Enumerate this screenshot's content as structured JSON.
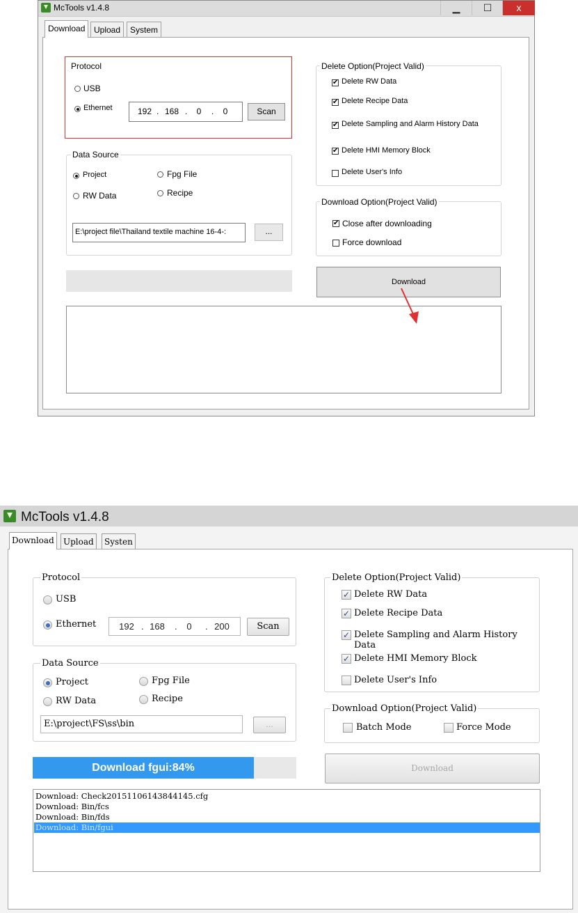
{
  "window1": {
    "title": "McTools v1.4.8",
    "controls": {
      "minimize": "▁",
      "maximize": "☐",
      "close": "x"
    },
    "tabs": [
      "Download",
      "Upload",
      "System"
    ],
    "protocol": {
      "legend": "Protocol",
      "usb_label": "USB",
      "ethernet_label": "Ethernet",
      "selected": "Ethernet",
      "ip": [
        "192",
        "168",
        "0",
        "0"
      ],
      "scan_label": "Scan",
      "highlight_color": "#e03030"
    },
    "data_source": {
      "legend": "Data Source",
      "options": [
        "Project",
        "Fpg File",
        "RW Data",
        "Recipe"
      ],
      "selected": "Project",
      "path": "E:\\project file\\Thailand textile machine 16-4-:",
      "browse_label": "..."
    },
    "delete_option": {
      "legend": "Delete Option(Project Valid)",
      "items": [
        {
          "label": "Delete RW Data",
          "checked": true
        },
        {
          "label": "Delete Recipe Data",
          "checked": true
        },
        {
          "label": "Delete Sampling and Alarm History Data",
          "checked": true
        },
        {
          "label": "Delete HMI Memory Block",
          "checked": true
        },
        {
          "label": "Delete User's Info",
          "checked": false
        }
      ]
    },
    "download_option": {
      "legend": "Download Option(Project Valid)",
      "items": [
        {
          "label": "Close after downloading",
          "checked": true
        },
        {
          "label": "Force download",
          "checked": false
        }
      ]
    },
    "download_label": "Download",
    "progress": 0,
    "arrow_color": "#e03030"
  },
  "window2": {
    "title": "McTools v1.4.8",
    "tabs": [
      "Download",
      "Upload",
      "Systen"
    ],
    "protocol": {
      "legend": "Protocol",
      "usb_label": "USB",
      "ethernet_label": "Ethernet",
      "selected": "Ethernet",
      "ip": [
        "192",
        "168",
        "0",
        "200"
      ],
      "scan_label": "Scan"
    },
    "data_source": {
      "legend": "Data Source",
      "options": [
        "Project",
        "Fpg File",
        "RW Data",
        "Recipe"
      ],
      "selected": "Project",
      "path": "E:\\project\\FS\\ss\\bin",
      "browse_label": "..."
    },
    "delete_option": {
      "legend": "Delete Option(Project Valid)",
      "items": [
        {
          "label": "Delete RW Data",
          "checked": true
        },
        {
          "label": "Delete Recipe Data",
          "checked": true
        },
        {
          "label": "Delete Sampling and Alarm History",
          "label_line2": "Data",
          "checked": true
        },
        {
          "label": "Delete HMI Memory Block",
          "checked": true
        },
        {
          "label": "Delete User's Info",
          "checked": false
        }
      ]
    },
    "download_option": {
      "legend": "Download Option(Project Valid)",
      "items": [
        {
          "label": "Batch Mode",
          "checked": false
        },
        {
          "label": "Force Mode",
          "checked": false
        }
      ]
    },
    "progress": {
      "text": "Download fgui:84%",
      "value": 84,
      "color": "#3399ee"
    },
    "download_label": "Download",
    "log": [
      "Download: Check20151106143844145.cfg",
      "Download: Bin/fcs",
      "Download: Bin/fds",
      "Download: Bin/fgui"
    ],
    "log_selected_index": 3
  }
}
